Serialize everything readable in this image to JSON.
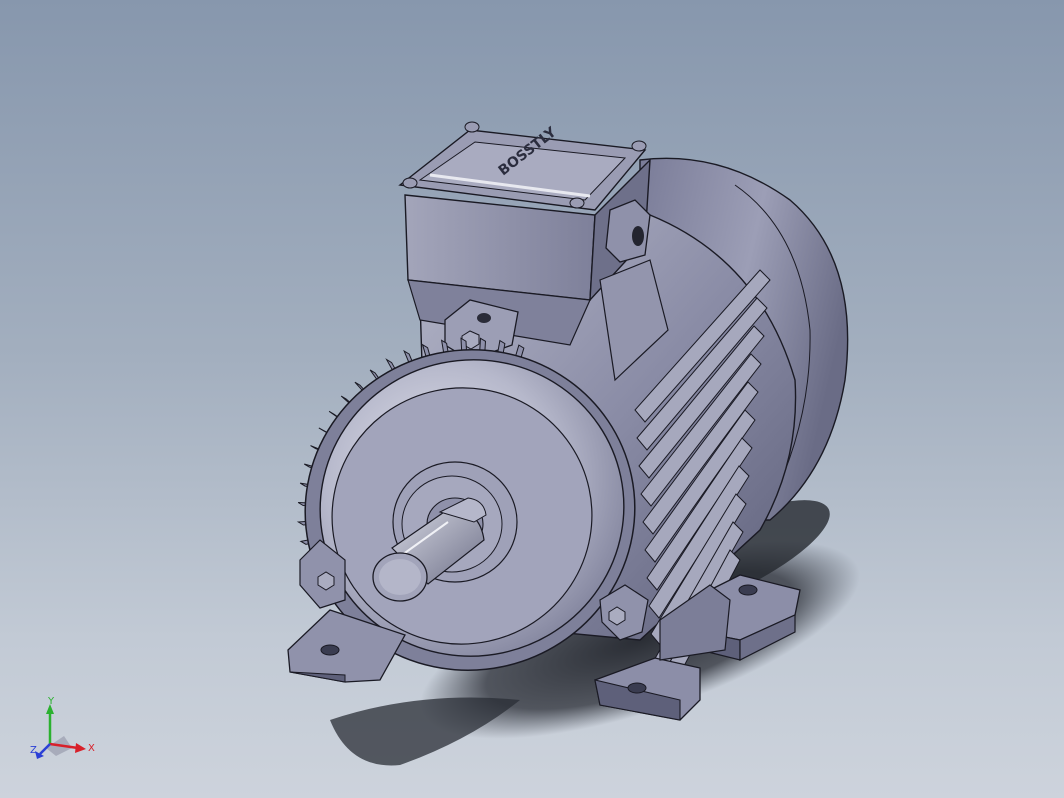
{
  "viewport": {
    "background_top": "#8797ad",
    "background_bottom": "#cdd3dc"
  },
  "model": {
    "body_color": "#8a8ca6",
    "light_color": "#d7d9e6",
    "edge_color": "#1a1a24",
    "shadow_color": "#2a2d35",
    "nameplate_text": "BOSSTLY"
  },
  "triad": {
    "x_label": "X",
    "y_label": "Y",
    "z_label": "Z",
    "x_color": "#d8202a",
    "y_color": "#2bb12f",
    "z_color": "#2b3fd6"
  }
}
